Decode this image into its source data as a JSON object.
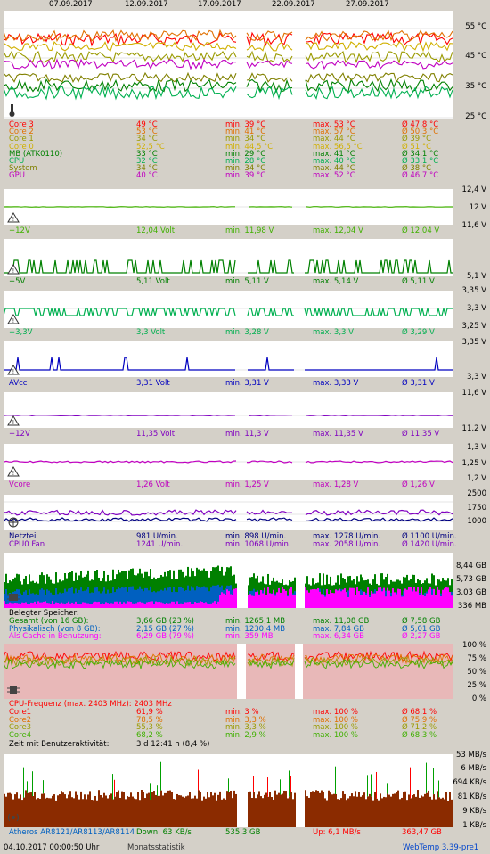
{
  "dates": [
    "07.09.2017",
    "12.09.2017",
    "17.09.2017",
    "22.09.2017",
    "27.09.2017"
  ],
  "temp": {
    "axis": [
      "55 °C",
      "45 °C",
      "35 °C",
      "25 °C"
    ],
    "rows": [
      {
        "name": "Core 3",
        "cur": "49 °C",
        "min": "min. 39 °C",
        "max": "max. 53 °C",
        "avg": "Ø 47,8 °C",
        "color": "#ff0000"
      },
      {
        "name": "Core 2",
        "cur": "53 °C",
        "min": "min. 41 °C",
        "max": "max. 57 °C",
        "avg": "Ø 50,3 °C",
        "color": "#e07000"
      },
      {
        "name": "Core 1",
        "cur": "34 °C",
        "min": "min. 34 °C",
        "max": "max. 44 °C",
        "avg": "Ø 39 °C",
        "color": "#9a9a00"
      },
      {
        "name": "Core 0",
        "cur": "52,5 °C",
        "min": "min. 44,5 °C",
        "max": "max. 56,5 °C",
        "avg": "Ø 51 °C",
        "color": "#d0b000"
      },
      {
        "name": "MB (ATK0110)",
        "cur": "33 °C",
        "min": "min. 29 °C",
        "max": "max. 41 °C",
        "avg": "Ø 34,1 °C",
        "color": "#008000"
      },
      {
        "name": "CPU",
        "cur": "32 °C",
        "min": "min. 28 °C",
        "max": "max. 40 °C",
        "avg": "Ø 33,1 °C",
        "color": "#00b050"
      },
      {
        "name": "System",
        "cur": "34 °C",
        "min": "min. 34 °C",
        "max": "max. 44 °C",
        "avg": "Ø 38 °C",
        "color": "#808000"
      },
      {
        "name": "GPU",
        "cur": "40 °C",
        "min": "min. 39 °C",
        "max": "max. 52 °C",
        "avg": "Ø 46,7 °C",
        "color": "#c000c0"
      }
    ]
  },
  "volt12": {
    "axis": [
      "12,4 V",
      "12 V",
      "11,6 V"
    ],
    "row": {
      "name": "+12V",
      "cur": "12,04 Volt",
      "min": "min. 11,98 V",
      "max": "max. 12,04 V",
      "avg": "Ø 12,04 V",
      "color": "#40b000"
    }
  },
  "volt5": {
    "axis": [
      "5,1 V"
    ],
    "row": {
      "name": "+5V",
      "cur": "5,11 Volt",
      "min": "min. 5,11 V",
      "max": "max. 5,14 V",
      "avg": "Ø 5,11 V",
      "color": "#008000"
    }
  },
  "volt33": {
    "axis": [
      "3,35 V",
      "3,3 V",
      "3,25 V"
    ],
    "row": {
      "name": "+3,3V",
      "cur": "3,3 Volt",
      "min": "min. 3,28 V",
      "max": "max. 3,3 V",
      "avg": "Ø 3,29 V",
      "color": "#00b050"
    }
  },
  "avcc": {
    "axis": [
      "3,35 V",
      "3,3 V"
    ],
    "row": {
      "name": "AVcc",
      "cur": "3,31 Volt",
      "min": "min. 3,31 V",
      "max": "max. 3,33 V",
      "avg": "Ø 3,31 V",
      "color": "#0000c0"
    }
  },
  "volt12b": {
    "axis": [
      "11,6 V",
      "11,2 V"
    ],
    "row": {
      "name": "+12V",
      "cur": "11,35 Volt",
      "min": "min. 11,3 V",
      "max": "max. 11,35 V",
      "avg": "Ø 11,35 V",
      "color": "#8000c0"
    }
  },
  "vcore": {
    "axis": [
      "1,3 V",
      "1,25 V",
      "1,2 V"
    ],
    "row": {
      "name": "Vcore",
      "cur": "1,26 Volt",
      "min": "min. 1,25 V",
      "max": "max. 1,28 V",
      "avg": "Ø 1,26 V",
      "color": "#c000c0"
    }
  },
  "fans": {
    "axis": [
      "2500",
      "1750",
      "1000"
    ],
    "rows": [
      {
        "name": "Netzteil",
        "cur": "981 U/min.",
        "min": "min. 898 U/min.",
        "max": "max. 1278 U/min.",
        "avg": "Ø 1100 U/min.",
        "color": "#000080"
      },
      {
        "name": "CPU0 Fan",
        "cur": "1241 U/min.",
        "min": "min. 1068 U/min.",
        "max": "max. 2058 U/min.",
        "avg": "Ø 1420 U/min.",
        "color": "#8000c0"
      }
    ]
  },
  "mem": {
    "axis": [
      "8,44 GB",
      "5,73 GB",
      "3,03 GB",
      "336 MB"
    ],
    "title": "Belegter Speicher:",
    "rows": [
      {
        "name": "Gesamt (von 16 GB):",
        "cur": "3,66 GB (23 %)",
        "min": "min. 1265,1 MB",
        "max": "max. 11,08 GB",
        "avg": "Ø 7,58 GB",
        "color": "#008000"
      },
      {
        "name": "Physikalisch (von 8 GB):",
        "cur": "2,15 GB (27 %)",
        "min": "min. 1230,4 MB",
        "max": "max. 7,84 GB",
        "avg": "Ø 5,01 GB",
        "color": "#0060c0"
      },
      {
        "name": "Als Cache in Benutzung:",
        "cur": "6,29 GB (79 %)",
        "min": "min. 359 MB",
        "max": "max. 6,34 GB",
        "avg": "Ø 2,27 GB",
        "color": "#ff00ff"
      }
    ]
  },
  "cpu": {
    "axis": [
      "100 %",
      "75 %",
      "50 %",
      "25 %",
      "0 %"
    ],
    "freq": "CPU-Frequenz (max. 2403 MHz): 2403 MHz",
    "rows": [
      {
        "name": "Core1",
        "cur": "61,9 %",
        "min": "min. 3 %",
        "max": "max. 100 %",
        "avg": "Ø 68,1 %",
        "color": "#ff0000"
      },
      {
        "name": "Core2",
        "cur": "78,5 %",
        "min": "min. 3,3 %",
        "max": "max. 100 %",
        "avg": "Ø 75,9 %",
        "color": "#e07000"
      },
      {
        "name": "Core3",
        "cur": "55,3 %",
        "min": "min. 3,3 %",
        "max": "max. 100 %",
        "avg": "Ø 71,2 %",
        "color": "#9a9a00"
      },
      {
        "name": "Core4",
        "cur": "68,2 %",
        "min": "min. 2,9 %",
        "max": "max. 100 %",
        "avg": "Ø 68,3 %",
        "color": "#40b000"
      }
    ],
    "uptime_label": "Zeit mit Benutzeraktivität:",
    "uptime_value": "3 d 12:41 h (8,4 %)"
  },
  "net": {
    "axis": [
      "53 MB/s",
      "6 MB/s",
      "694 KB/s",
      "81 KB/s",
      "9 KB/s",
      "1 KB/s"
    ],
    "name": "Atheros AR8121/AR8113/AR8114",
    "down": "Down: 63 KB/s",
    "total_down": "535,3 GB",
    "up": "Up: 6,1 MB/s",
    "total_up": "363,47 GB"
  },
  "footer": {
    "timestamp": "04.10.2017 00:00:50 Uhr",
    "link": "Monatsstatistik",
    "version": "WebTemp 3.39-pre1"
  }
}
